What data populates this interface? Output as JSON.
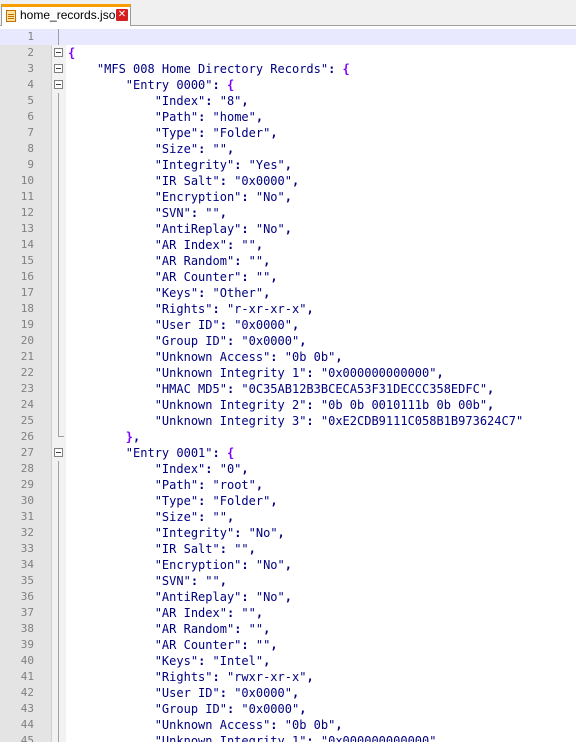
{
  "tab": {
    "title": "home_records.json",
    "close_glyph": "✕",
    "icons": [
      "file-icon",
      "close-icon"
    ]
  },
  "editor": {
    "current_line": 1,
    "lines": [
      {
        "n": "1",
        "fold": "line"
      },
      {
        "n": "2",
        "fold": "box",
        "indent": 0,
        "open": "{"
      },
      {
        "n": "3",
        "fold": "box",
        "indent": 1,
        "key": "\"MFS 008 Home Directory Records\"",
        "open": "{"
      },
      {
        "n": "4",
        "fold": "box",
        "indent": 2,
        "key": "\"Entry 0000\"",
        "open": "{"
      },
      {
        "n": "5",
        "fold": "line",
        "indent": 3,
        "key": "\"Index\"",
        "value": "\"8\"",
        "comma": true
      },
      {
        "n": "6",
        "fold": "line",
        "indent": 3,
        "key": "\"Path\"",
        "value": "\"home\"",
        "comma": true
      },
      {
        "n": "7",
        "fold": "line",
        "indent": 3,
        "key": "\"Type\"",
        "value": "\"Folder\"",
        "comma": true
      },
      {
        "n": "8",
        "fold": "line",
        "indent": 3,
        "key": "\"Size\"",
        "value": "\"\"",
        "comma": true
      },
      {
        "n": "9",
        "fold": "line",
        "indent": 3,
        "key": "\"Integrity\"",
        "value": "\"Yes\"",
        "comma": true
      },
      {
        "n": "10",
        "fold": "line",
        "indent": 3,
        "key": "\"IR Salt\"",
        "value": "\"0x0000\"",
        "comma": true
      },
      {
        "n": "11",
        "fold": "line",
        "indent": 3,
        "key": "\"Encryption\"",
        "value": "\"No\"",
        "comma": true
      },
      {
        "n": "12",
        "fold": "line",
        "indent": 3,
        "key": "\"SVN\"",
        "value": "\"\"",
        "comma": true
      },
      {
        "n": "13",
        "fold": "line",
        "indent": 3,
        "key": "\"AntiReplay\"",
        "value": "\"No\"",
        "comma": true
      },
      {
        "n": "14",
        "fold": "line",
        "indent": 3,
        "key": "\"AR Index\"",
        "value": "\"\"",
        "comma": true
      },
      {
        "n": "15",
        "fold": "line",
        "indent": 3,
        "key": "\"AR Random\"",
        "value": "\"\"",
        "comma": true
      },
      {
        "n": "16",
        "fold": "line",
        "indent": 3,
        "key": "\"AR Counter\"",
        "value": "\"\"",
        "comma": true
      },
      {
        "n": "17",
        "fold": "line",
        "indent": 3,
        "key": "\"Keys\"",
        "value": "\"Other\"",
        "comma": true
      },
      {
        "n": "18",
        "fold": "line",
        "indent": 3,
        "key": "\"Rights\"",
        "value": "\"r-xr-xr-x\"",
        "comma": true
      },
      {
        "n": "19",
        "fold": "line",
        "indent": 3,
        "key": "\"User ID\"",
        "value": "\"0x0000\"",
        "comma": true
      },
      {
        "n": "20",
        "fold": "line",
        "indent": 3,
        "key": "\"Group ID\"",
        "value": "\"0x0000\"",
        "comma": true
      },
      {
        "n": "21",
        "fold": "line",
        "indent": 3,
        "key": "\"Unknown Access\"",
        "value": "\"0b 0b\"",
        "comma": true
      },
      {
        "n": "22",
        "fold": "line",
        "indent": 3,
        "key": "\"Unknown Integrity 1\"",
        "value": "\"0x000000000000\"",
        "comma": true
      },
      {
        "n": "23",
        "fold": "line",
        "indent": 3,
        "key": "\"HMAC MD5\"",
        "value": "\"0C35AB12B3BCECA53F31DECCC358EDFC\"",
        "comma": true
      },
      {
        "n": "24",
        "fold": "line",
        "indent": 3,
        "key": "\"Unknown Integrity 2\"",
        "value": "\"0b 0b 0010111b 0b 00b\"",
        "comma": true
      },
      {
        "n": "25",
        "fold": "line",
        "indent": 3,
        "key": "\"Unknown Integrity 3\"",
        "value": "\"0xE2CDB9111C058B1B973624C7\"",
        "comma": false
      },
      {
        "n": "26",
        "fold": "end",
        "indent": 2,
        "close": "}",
        "comma": true
      },
      {
        "n": "27",
        "fold": "box",
        "indent": 2,
        "key": "\"Entry 0001\"",
        "open": "{"
      },
      {
        "n": "28",
        "fold": "line",
        "indent": 3,
        "key": "\"Index\"",
        "value": "\"0\"",
        "comma": true
      },
      {
        "n": "29",
        "fold": "line",
        "indent": 3,
        "key": "\"Path\"",
        "value": "\"root\"",
        "comma": true
      },
      {
        "n": "30",
        "fold": "line",
        "indent": 3,
        "key": "\"Type\"",
        "value": "\"Folder\"",
        "comma": true
      },
      {
        "n": "31",
        "fold": "line",
        "indent": 3,
        "key": "\"Size\"",
        "value": "\"\"",
        "comma": true
      },
      {
        "n": "32",
        "fold": "line",
        "indent": 3,
        "key": "\"Integrity\"",
        "value": "\"No\"",
        "comma": true
      },
      {
        "n": "33",
        "fold": "line",
        "indent": 3,
        "key": "\"IR Salt\"",
        "value": "\"\"",
        "comma": true
      },
      {
        "n": "34",
        "fold": "line",
        "indent": 3,
        "key": "\"Encryption\"",
        "value": "\"No\"",
        "comma": true
      },
      {
        "n": "35",
        "fold": "line",
        "indent": 3,
        "key": "\"SVN\"",
        "value": "\"\"",
        "comma": true
      },
      {
        "n": "36",
        "fold": "line",
        "indent": 3,
        "key": "\"AntiReplay\"",
        "value": "\"No\"",
        "comma": true
      },
      {
        "n": "37",
        "fold": "line",
        "indent": 3,
        "key": "\"AR Index\"",
        "value": "\"\"",
        "comma": true
      },
      {
        "n": "38",
        "fold": "line",
        "indent": 3,
        "key": "\"AR Random\"",
        "value": "\"\"",
        "comma": true
      },
      {
        "n": "39",
        "fold": "line",
        "indent": 3,
        "key": "\"AR Counter\"",
        "value": "\"\"",
        "comma": true
      },
      {
        "n": "40",
        "fold": "line",
        "indent": 3,
        "key": "\"Keys\"",
        "value": "\"Intel\"",
        "comma": true
      },
      {
        "n": "41",
        "fold": "line",
        "indent": 3,
        "key": "\"Rights\"",
        "value": "\"rwxr-xr-x\"",
        "comma": true
      },
      {
        "n": "42",
        "fold": "line",
        "indent": 3,
        "key": "\"User ID\"",
        "value": "\"0x0000\"",
        "comma": true
      },
      {
        "n": "43",
        "fold": "line",
        "indent": 3,
        "key": "\"Group ID\"",
        "value": "\"0x0000\"",
        "comma": true
      },
      {
        "n": "44",
        "fold": "line",
        "indent": 3,
        "key": "\"Unknown Access\"",
        "value": "\"0b 0b\"",
        "comma": true
      },
      {
        "n": "45",
        "fold": "line",
        "indent": 3,
        "key": "\"Unknown Integrity 1\"",
        "value": "\"0x000000000000\"",
        "comma": true
      }
    ]
  }
}
